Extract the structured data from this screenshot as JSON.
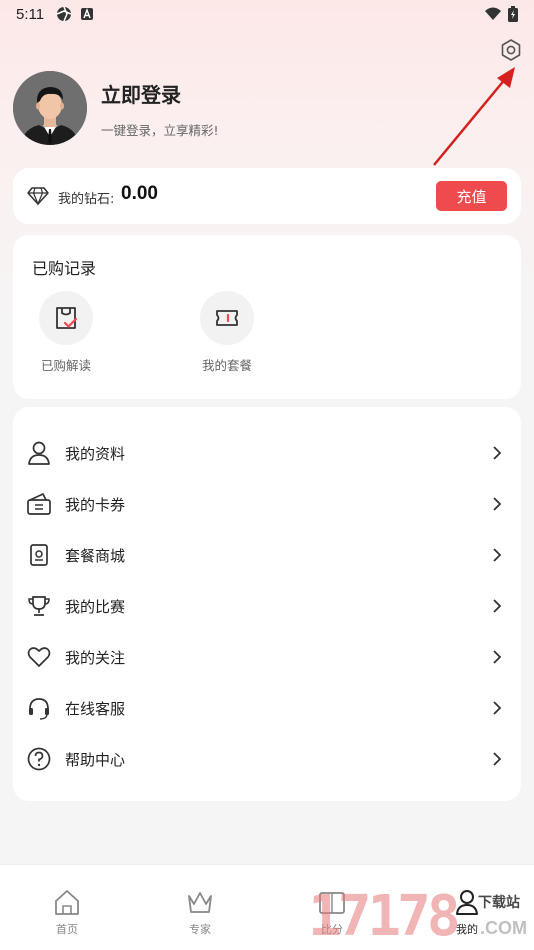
{
  "status_bar": {
    "time": "5:11"
  },
  "profile": {
    "login_title": "立即登录",
    "login_subtitle": "一键登录，立享精彩!"
  },
  "wallet": {
    "label": "我的钻石:",
    "value": "0.00",
    "recharge_label": "充值"
  },
  "purchases": {
    "title": "已购记录",
    "items": [
      {
        "label": "已购解读",
        "icon": "purchased-reading-icon"
      },
      {
        "label": "我的套餐",
        "icon": "ticket-icon"
      }
    ]
  },
  "menu": {
    "items": [
      {
        "label": "我的资料",
        "icon": "user-icon"
      },
      {
        "label": "我的卡券",
        "icon": "wallet-icon"
      },
      {
        "label": "套餐商城",
        "icon": "package-icon"
      },
      {
        "label": "我的比赛",
        "icon": "trophy-icon"
      },
      {
        "label": "我的关注",
        "icon": "heart-icon"
      },
      {
        "label": "在线客服",
        "icon": "headset-icon"
      },
      {
        "label": "帮助中心",
        "icon": "help-icon"
      }
    ]
  },
  "bottom_nav": {
    "items": [
      {
        "label": "首页",
        "icon": "home-icon"
      },
      {
        "label": "专家",
        "icon": "crown-icon"
      },
      {
        "label": "比分",
        "icon": "scoreboard-icon"
      },
      {
        "label": "我的",
        "icon": "profile-icon",
        "active": true
      }
    ]
  },
  "watermark": {
    "digits": "17178",
    "text": "下载站",
    "suffix": ".COM"
  },
  "colors": {
    "accent": "#ef4b4f",
    "annotation_arrow": "#d62020"
  }
}
